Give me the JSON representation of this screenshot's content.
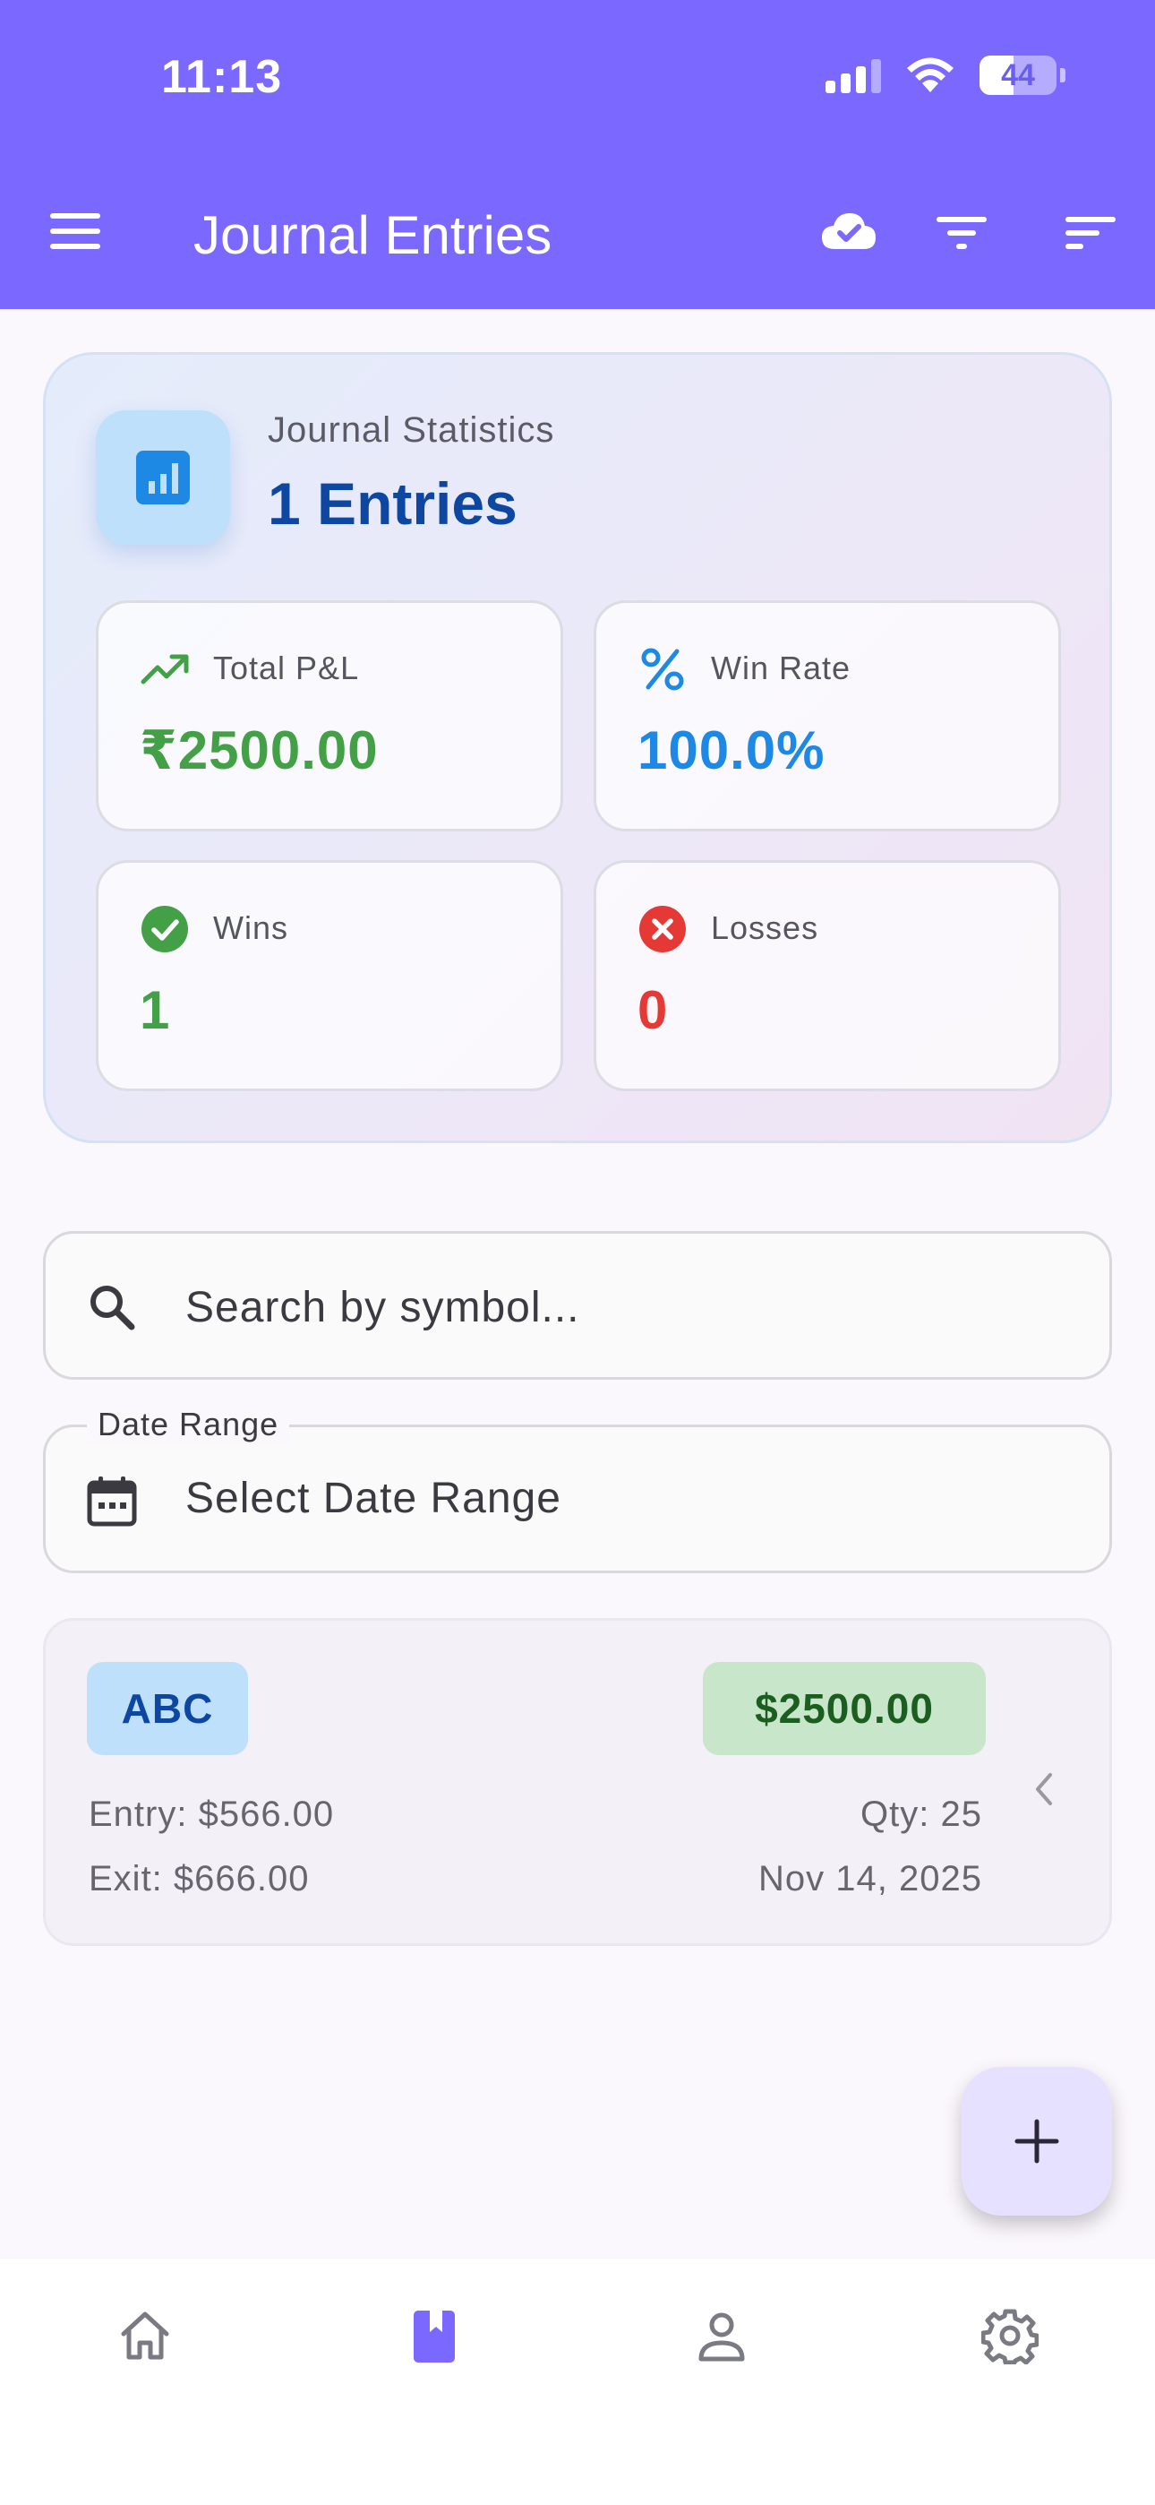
{
  "status_bar": {
    "time": "11:13",
    "battery": "44",
    "battery_level": 0.44
  },
  "appbar": {
    "title": "Journal Entries",
    "icons": [
      "menu-icon",
      "cloud-check-icon",
      "filter-icon",
      "sort-icon"
    ]
  },
  "stats": {
    "label": "Journal Statistics",
    "count": "1 Entries",
    "icon": "chart-icon",
    "tiles": [
      {
        "label": "Total P&L",
        "value": "₹2500.00",
        "icon": "trending-up-icon",
        "color": "#43a047"
      },
      {
        "label": "Win Rate",
        "value": "100.0%",
        "icon": "percent-icon",
        "color": "#1e88e5"
      },
      {
        "label": "Wins",
        "value": "1",
        "icon": "check-circle-icon",
        "color": "#43a047"
      },
      {
        "label": "Losses",
        "value": "0",
        "icon": "cancel-circle-icon",
        "color": "#e53935"
      }
    ]
  },
  "search": {
    "placeholder": "Search by symbol..."
  },
  "date_range": {
    "label": "Date Range",
    "value": "Select Date Range"
  },
  "trade": {
    "symbol": "ABC",
    "pnl": "$2500.00",
    "entry": "Entry: $566.00",
    "exit": "Exit: $666.00",
    "qty": "Qty: 25",
    "date": "Nov 14, 2025"
  },
  "colors": {
    "primary": "#7b68fe",
    "profit": "#43a047",
    "loss": "#e53935",
    "accent_blue": "#1e88e5"
  },
  "bottom_nav": [
    {
      "name": "home",
      "icon": "home-icon",
      "active": false
    },
    {
      "name": "journal",
      "icon": "journal-icon",
      "active": true
    },
    {
      "name": "profile",
      "icon": "person-icon",
      "active": false
    },
    {
      "name": "settings",
      "icon": "gear-icon",
      "active": false
    }
  ]
}
